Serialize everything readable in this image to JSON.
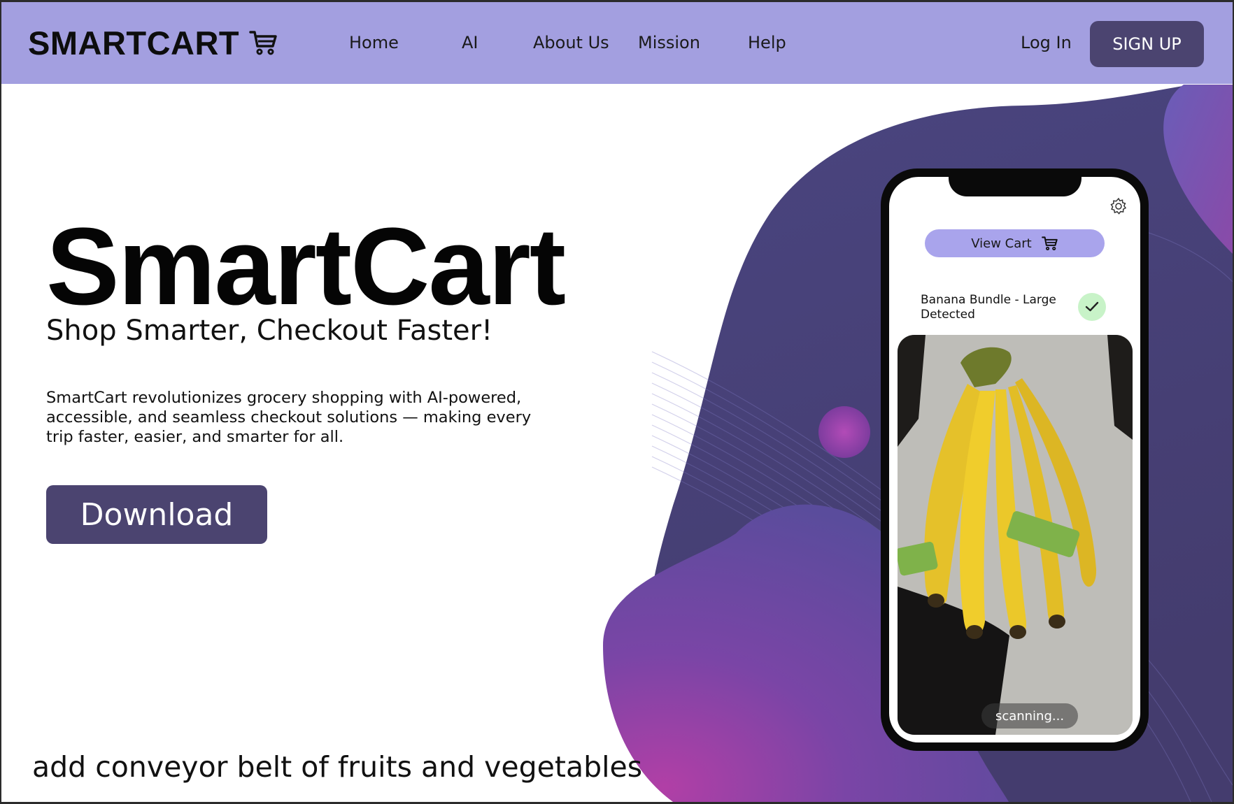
{
  "nav": {
    "logo_text": "SMARTCART",
    "links": [
      "Home",
      "AI",
      "About Us",
      "Mission",
      "Help"
    ],
    "login_label": "Log In",
    "signup_label": "SIGN UP"
  },
  "hero": {
    "title": "SmartCart",
    "subtitle": "Shop Smarter, Checkout Faster!",
    "description": "SmartCart revolutionizes grocery shopping with AI-powered, accessible, and seamless checkout solutions — making every trip faster, easier, and smarter for all.",
    "download_label": "Download"
  },
  "phone": {
    "view_cart_label": "View Cart",
    "detected_text": "Banana Bundle - Large Detected",
    "status_text": "scanning..."
  },
  "note": "add conveyor belt of fruits and vegetables",
  "colors": {
    "nav_bg": "#a39fe0",
    "button_bg": "#4b4470",
    "blob_dark": "#4a4378",
    "blob_purple": "#8a3fa8",
    "view_cart_bg": "#a9a4ec",
    "check_bg": "#c8f3c8"
  },
  "icons": [
    "cart-icon",
    "gear-icon",
    "check-icon"
  ]
}
